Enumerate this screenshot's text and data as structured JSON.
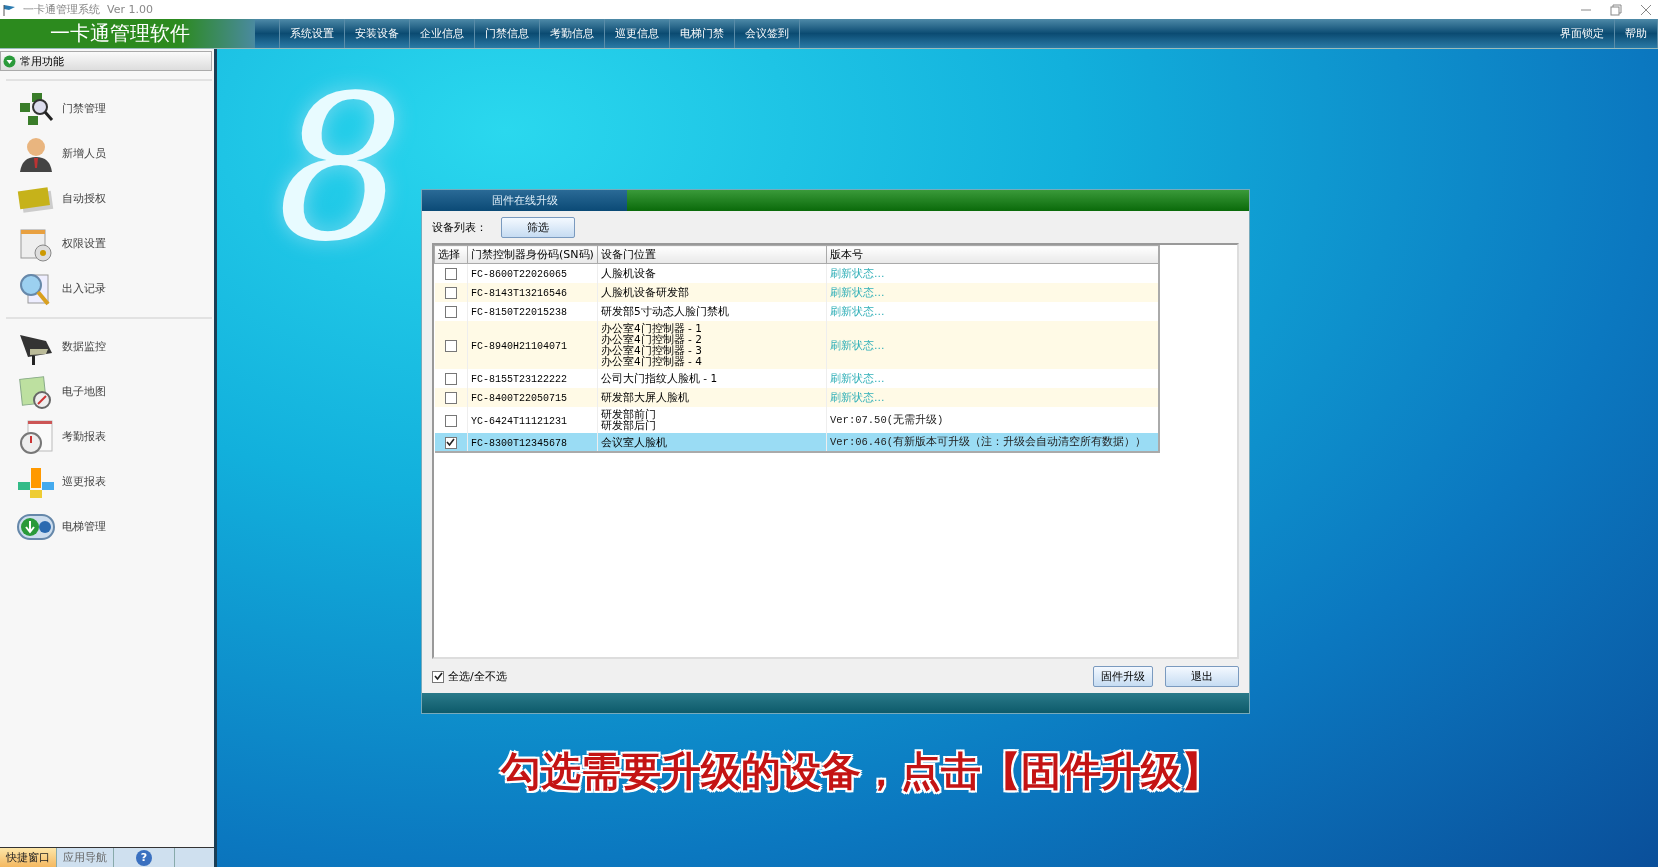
{
  "window": {
    "title": "一卡通管理系统  Ver 1.00"
  },
  "menu_bar": {
    "app_name": "一卡通管理软件",
    "items": [
      "系统设置",
      "安装设备",
      "企业信息",
      "门禁信息",
      "考勤信息",
      "巡更信息",
      "电梯门禁",
      "会议签到"
    ],
    "right_items": [
      "界面锁定",
      "帮助"
    ]
  },
  "sidebar": {
    "header": "常用功能",
    "expanded": true,
    "groups": [
      [
        "门禁管理",
        "新增人员",
        "自动授权",
        "权限设置",
        "出入记录"
      ],
      [
        "数据监控",
        "电子地图",
        "考勤报表",
        "巡更报表",
        "电梯管理"
      ]
    ],
    "bottom_tabs": [
      {
        "label": "快捷窗口",
        "selected": true,
        "kind": "text"
      },
      {
        "label": "应用导航",
        "selected": false,
        "kind": "text"
      },
      {
        "label": "?",
        "selected": false,
        "kind": "icon"
      }
    ]
  },
  "splash": {
    "logo": "8"
  },
  "dialog": {
    "title": "固件在线升级",
    "list_label": "设备列表：",
    "filter_button": "筛选",
    "table": {
      "columns": [
        "选择",
        "门禁控制器身份码(SN码)",
        "设备门位置",
        "版本号"
      ],
      "rows": [
        {
          "checked": false,
          "selected": false,
          "sn": "FC-8600T22026065",
          "locations": [
            "人脸机设备"
          ],
          "status": {
            "kind": "refreshing",
            "text": "刷新状态..."
          }
        },
        {
          "checked": false,
          "selected": false,
          "sn": "FC-8143T13216546",
          "locations": [
            "人脸机设备研发部"
          ],
          "status": {
            "kind": "refreshing",
            "text": "刷新状态..."
          }
        },
        {
          "checked": false,
          "selected": false,
          "sn": "FC-8150T22015238",
          "locations": [
            "研发部5寸动态人脸门禁机"
          ],
          "status": {
            "kind": "refreshing",
            "text": "刷新状态..."
          }
        },
        {
          "checked": false,
          "selected": false,
          "sn": "FC-8940H21104071",
          "locations": [
            "办公室4门控制器 - 1",
            "办公室4门控制器 - 2",
            "办公室4门控制器 - 3",
            "办公室4门控制器 - 4"
          ],
          "status": {
            "kind": "refreshing",
            "text": "刷新状态..."
          }
        },
        {
          "checked": false,
          "selected": false,
          "sn": "FC-8155T23122222",
          "locations": [
            "公司大门指纹人脸机 - 1"
          ],
          "status": {
            "kind": "refreshing",
            "text": "刷新状态..."
          }
        },
        {
          "checked": false,
          "selected": false,
          "sn": "FC-8400T22050715",
          "locations": [
            "研发部大屏人脸机"
          ],
          "status": {
            "kind": "refreshing",
            "text": "刷新状态..."
          }
        },
        {
          "checked": false,
          "selected": false,
          "sn": "YC-6424T11121231",
          "locations": [
            "研发部前门",
            "研发部后门"
          ],
          "status": {
            "kind": "version",
            "text": "Ver:07.50(无需升级)"
          }
        },
        {
          "checked": true,
          "selected": true,
          "sn": "FC-8300T12345678",
          "locations": [
            "会议室人脸机"
          ],
          "status": {
            "kind": "version",
            "text": "Ver:06.46(有新版本可升级（注：升级会自动清空所有数据））"
          }
        }
      ]
    },
    "select_all": {
      "label": "全选/全不选",
      "checked": true
    },
    "buttons": [
      "固件升级",
      "退出"
    ]
  },
  "caption": "勾选需要升级的设备，点击【固件升级】"
}
